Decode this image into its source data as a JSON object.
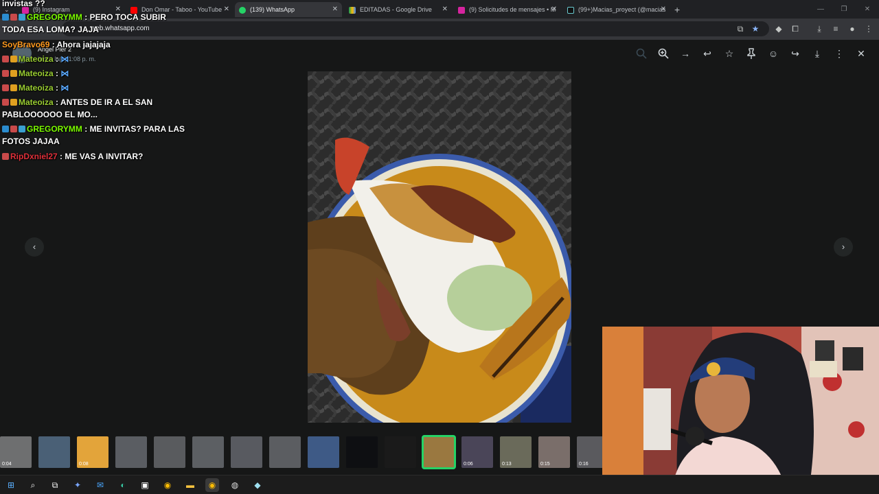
{
  "browser": {
    "tabs": [
      {
        "label": "(9) Instagram",
        "active": false
      },
      {
        "label": "Don Omar - Taboo - YouTube",
        "active": false
      },
      {
        "label": "(139) WhatsApp",
        "active": true
      },
      {
        "label": "EDITADAS - Google Drive",
        "active": false
      },
      {
        "label": "(9) Solicitudes de mensajes • M",
        "active": false
      },
      {
        "label": "(99+)Macias_proyect (@macias",
        "active": false
      }
    ],
    "url": "web.whatsapp.com",
    "new_tab": "+",
    "close_glyph": "✕"
  },
  "viewer": {
    "sender_name": "Angel Pier 2",
    "timestamp": "hoy a la(s) 1:08 p. m.",
    "prev_glyph": "‹",
    "next_glyph": "›"
  },
  "thumbnails": [
    {
      "duration": "0:04",
      "color": "#6e6f70"
    },
    {
      "duration": "",
      "color": "#4a6076"
    },
    {
      "duration": "0:08",
      "color": "#e3a43a"
    },
    {
      "duration": "",
      "color": "#5a5d62"
    },
    {
      "duration": "",
      "color": "#595b5e"
    },
    {
      "duration": "",
      "color": "#5c5f63"
    },
    {
      "duration": "",
      "color": "#585a60"
    },
    {
      "duration": "",
      "color": "#5b5d61"
    },
    {
      "duration": "",
      "color": "#3e5a86"
    },
    {
      "duration": "",
      "color": "#0e0f12"
    },
    {
      "duration": "",
      "color": "#1a1a1a"
    },
    {
      "duration": "",
      "color": "#9a7840",
      "selected": true
    },
    {
      "duration": "0:06",
      "color": "#4a4558"
    },
    {
      "duration": "0:13",
      "color": "#6a6a5a"
    },
    {
      "duration": "0:15",
      "color": "#7a6e6a"
    },
    {
      "duration": "0:16",
      "color": "#5a5a5e"
    }
  ],
  "chat": [
    {
      "user": "",
      "text": "invistas ??",
      "color": "#ffffff"
    },
    {
      "user": "GREGORYMM",
      "text": ": PERO TOCA SUBIR",
      "color": "#7cfc00"
    },
    {
      "user": "",
      "text": "TODA ESA LOMA? JAJA",
      "color": "#ffffff"
    },
    {
      "user": "SoyBravo69",
      "text": ": Ahora jajajaja",
      "color": "#ff9a1f"
    },
    {
      "user": "Mateoiza",
      "text": ":",
      "color": "#9acd32"
    },
    {
      "user": "Mateoiza",
      "text": ":",
      "color": "#9acd32"
    },
    {
      "user": "Mateoiza",
      "text": ":",
      "color": "#9acd32"
    },
    {
      "user": "Mateoiza",
      "text": ": ANTES DE IR A EL SAN",
      "color": "#9acd32"
    },
    {
      "user": "",
      "text": "PABLOOOOOO EL MO...",
      "color": "#ffffff"
    },
    {
      "user": "GREGORYMM",
      "text": ": ME INVITAS? PARA LAS",
      "color": "#7cfc00"
    },
    {
      "user": "",
      "text": "FOTOS JAJAA",
      "color": "#ffffff"
    },
    {
      "user": "RipDxniel27",
      "text": ": ME VAS A INVITAR?",
      "color": "#e0303a"
    }
  ],
  "colors": {
    "accent": "#25d366",
    "viewer_bg": "#161717",
    "tab_bg": "#202124"
  }
}
